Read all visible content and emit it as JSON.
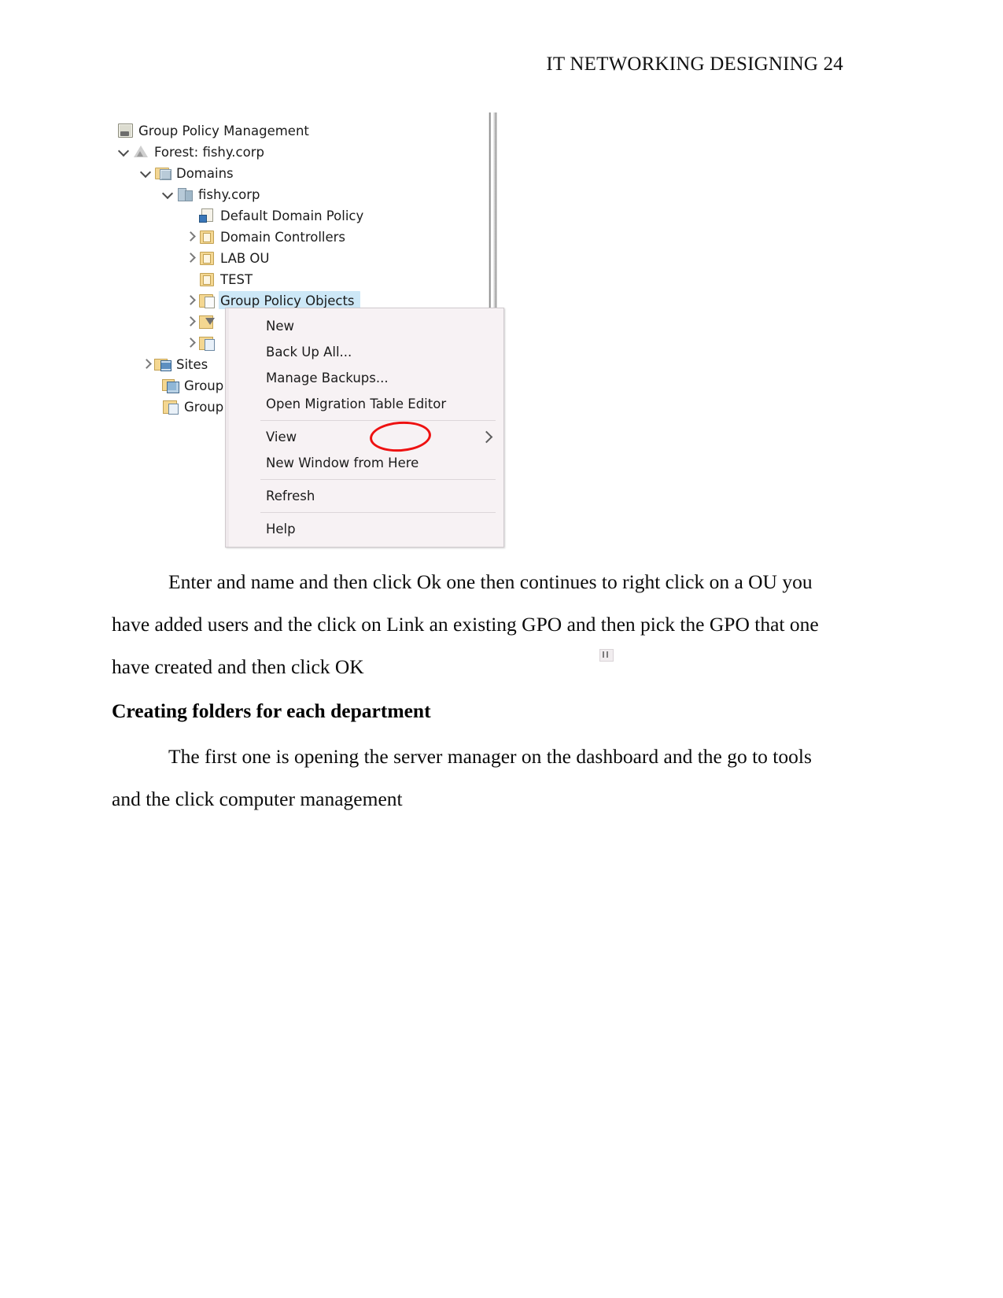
{
  "page": {
    "header_text": "IT NETWORKING DESIGNING 24"
  },
  "figure": {
    "app_title": "Group Policy Management",
    "tree": [
      {
        "label": "Group Policy Management",
        "icon": "console-icon",
        "expander": "none",
        "selected": false,
        "depth": 0
      },
      {
        "label": "Forest: fishy.corp",
        "icon": "forest-icon",
        "expander": "expanded",
        "selected": false,
        "depth": 1
      },
      {
        "label": "Domains",
        "icon": "domains-icon",
        "expander": "expanded",
        "selected": false,
        "depth": 2
      },
      {
        "label": "fishy.corp",
        "icon": "domain-icon",
        "expander": "expanded",
        "selected": false,
        "depth": 3
      },
      {
        "label": "Default Domain Policy",
        "icon": "policy-icon",
        "expander": "none",
        "selected": false,
        "depth": 4
      },
      {
        "label": "Domain Controllers",
        "icon": "ou-icon",
        "expander": "collapsed",
        "selected": false,
        "depth": 4
      },
      {
        "label": "LAB OU",
        "icon": "ou-icon",
        "expander": "collapsed",
        "selected": false,
        "depth": 4
      },
      {
        "label": "TEST",
        "icon": "ou-icon",
        "expander": "none",
        "selected": false,
        "depth": 4
      },
      {
        "label": "Group Policy Objects",
        "icon": "gpo-folder-icon",
        "expander": "collapsed",
        "selected": true,
        "depth": 4
      },
      {
        "label": "",
        "icon": "wmi-filter-icon",
        "expander": "collapsed",
        "selected": false,
        "depth": 4
      },
      {
        "label": "",
        "icon": "starter-gpo-icon",
        "expander": "collapsed",
        "selected": false,
        "depth": 4
      },
      {
        "label": "Sites",
        "icon": "sites-icon",
        "expander": "collapsed",
        "selected": false,
        "depth": 2
      },
      {
        "label": "Group",
        "icon": "gp-modeling-icon",
        "expander": "none",
        "selected": false,
        "depth": 2
      },
      {
        "label": "Group",
        "icon": "gp-results-icon",
        "expander": "none",
        "selected": false,
        "depth": 2
      }
    ],
    "context_menu": {
      "items": [
        {
          "label": "New",
          "submenu": false,
          "annotated": true
        },
        {
          "label": "Back Up All...",
          "submenu": false,
          "annotated": false
        },
        {
          "label": "Manage Backups...",
          "submenu": false,
          "annotated": false
        },
        {
          "label": "Open Migration Table Editor",
          "submenu": false,
          "annotated": false
        },
        {
          "separator": true
        },
        {
          "label": "View",
          "submenu": true,
          "annotated": false
        },
        {
          "label": "New Window from Here",
          "submenu": false,
          "annotated": false
        },
        {
          "separator": true
        },
        {
          "label": "Refresh",
          "submenu": false,
          "annotated": false
        },
        {
          "separator": true
        },
        {
          "label": "Help",
          "submenu": false,
          "annotated": false
        }
      ],
      "annotation_color": "#ee1111"
    }
  },
  "content": {
    "paragraph_1": "Enter and name and then click Ok one then continues to right click on a OU you have added users and the click on Link an existing GPO and then pick the GPO that one have created and then click OK",
    "heading_1": "Creating folders for each department",
    "paragraph_2": "The first one is opening the server manager on the dashboard and the go to tools and the click computer management"
  }
}
